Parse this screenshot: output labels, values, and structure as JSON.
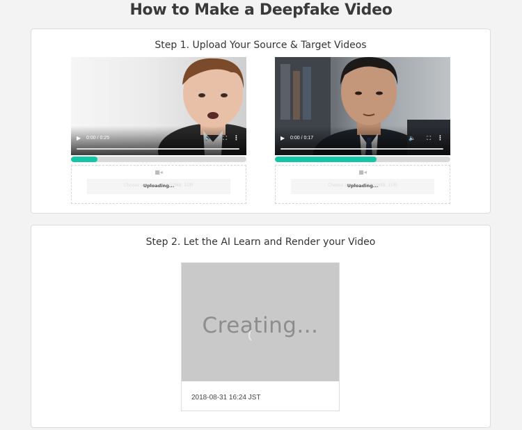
{
  "page": {
    "title": "How to Make a Deepfake Video"
  },
  "step1": {
    "title": "Step 1. Upload Your Source & Target Videos",
    "source": {
      "time": "0:00 / 0:25",
      "progress": 0.15,
      "upload_status": "Uploading...",
      "ghost_text": "Choose a video... 最大50MB, 15秒",
      "icons": {
        "play": "play-icon",
        "volume": "volume-icon",
        "fullscreen": "fullscreen-icon",
        "more": "more-icon",
        "camera": "video-camera-icon"
      }
    },
    "target": {
      "time": "0:00 / 0:17",
      "progress": 0.58,
      "upload_status": "Uploading...",
      "ghost_text": "Choose a video... 最大50MB, 15秒"
    }
  },
  "step2": {
    "title": "Step 2. Let the AI Learn and Render your Video",
    "creating_text": "Creating...",
    "timestamp": "2018-08-31 16:24 JST"
  },
  "colors": {
    "accent": "#16c5a6",
    "render_bg": "#c9c9c9"
  }
}
